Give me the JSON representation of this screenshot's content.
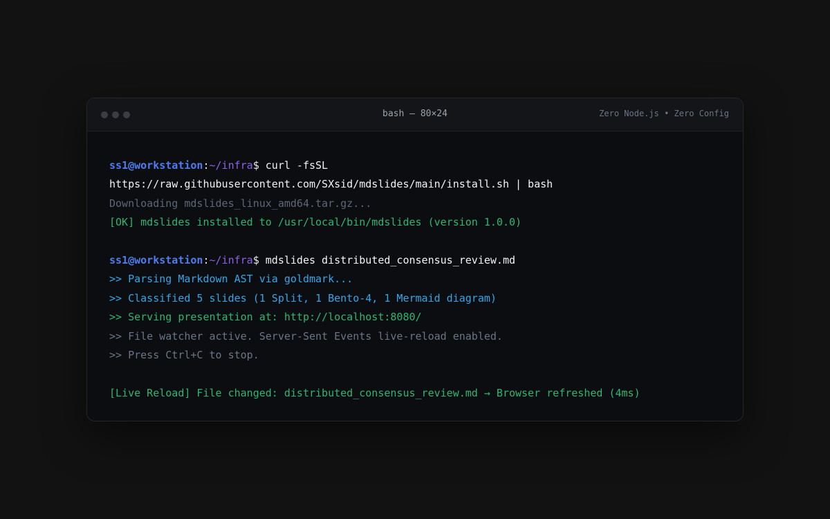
{
  "window": {
    "title": "bash — 80×24",
    "tagline": "Zero Node.js • Zero Config"
  },
  "prompt": {
    "user": "ss1@workstation",
    "colon": ":",
    "path": "~/infra",
    "symbol": "$"
  },
  "lines": {
    "cmd1": " curl -fsSL",
    "cmd1_cont": "https://raw.githubusercontent.com/SXsid/mdslides/main/install.sh | bash",
    "download": "Downloading mdslides_linux_amd64.tar.gz...",
    "ok": "[OK] mdslides installed to /usr/local/bin/mdslides (version 1.0.0)",
    "cmd2": " mdslides distributed_consensus_review.md",
    "parse": ">> Parsing Markdown AST via goldmark...",
    "classify": ">> Classified 5 slides (1 Split, 1 Bento-4, 1 Mermaid diagram)",
    "serve": ">> Serving presentation at: http://localhost:8080/",
    "watch": ">> File watcher active. Server-Sent Events live-reload enabled.",
    "stop": ">> Press Ctrl+C to stop.",
    "reload": "[Live Reload] File changed: distributed_consensus_review.md → Browser refreshed (4ms)"
  },
  "colors": {
    "user": "#4f7cf0",
    "path": "#8b62e6",
    "ok": "#2fb672",
    "info": "#35a6e8",
    "dim": "#5e6777"
  }
}
